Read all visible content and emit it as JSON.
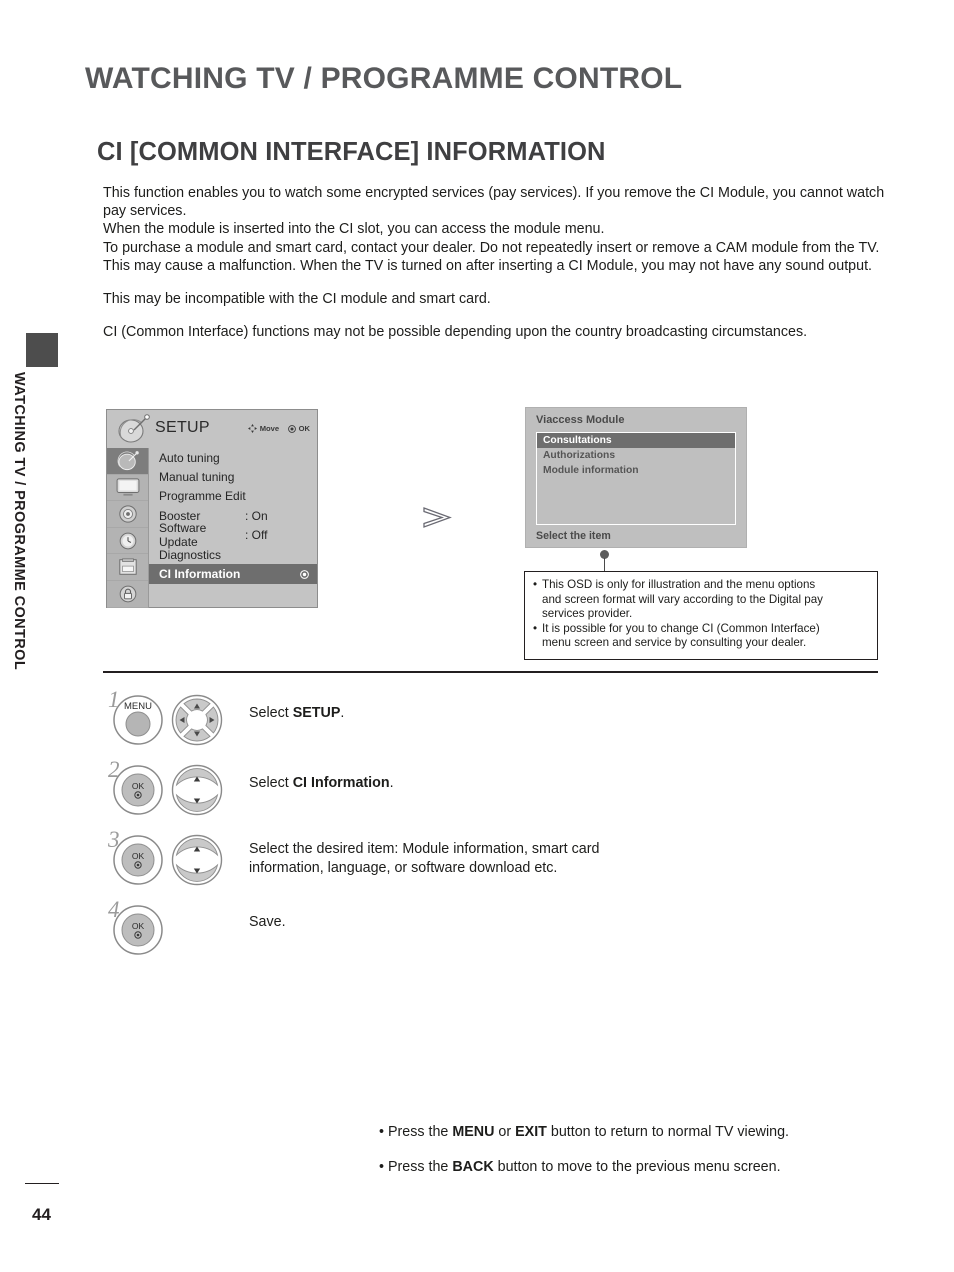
{
  "document": {
    "running_head": "WATCHING TV / PROGRAMME CONTROL",
    "side_tab_text": "WATCHING TV / PROGRAMME CONTROL",
    "section_title": "CI [COMMON INTERFACE] INFORMATION",
    "page_number": "44"
  },
  "body": {
    "paragraph_1": "This function enables you to watch some encrypted services (pay services). If you remove the CI Module, you cannot watch pay services.\nWhen the module is inserted into the CI slot, you can access the module menu.\nTo purchase a module and smart card, contact your dealer. Do not repeatedly insert or remove a CAM module from the TV. This may cause a malfunction. When the TV is turned on after inserting a CI Module, you may not have any sound output.",
    "paragraph_2": "This may be incompatible with the CI module and smart card.",
    "paragraph_3": "CI (Common Interface) functions may not be possible depending upon the country broadcasting circumstances."
  },
  "setup_osd": {
    "title": "SETUP",
    "hint_move": "Move",
    "hint_ok": "OK",
    "sidebar_icons": [
      "satellite-dish-icon",
      "tv-screen-icon",
      "speaker-icon",
      "clock-timer-icon",
      "setup-box-icon",
      "lock-icon"
    ],
    "items": [
      {
        "label": "Auto tuning",
        "value": ""
      },
      {
        "label": "Manual tuning",
        "value": ""
      },
      {
        "label": "Programme Edit",
        "value": ""
      },
      {
        "label": "Booster",
        "value": ": On"
      },
      {
        "label": "Software Update",
        "value": ": Off"
      },
      {
        "label": "Diagnostics",
        "value": ""
      },
      {
        "label": "CI Information",
        "value": "",
        "selected": true
      }
    ]
  },
  "viaccess_osd": {
    "title": "Viaccess Module",
    "items": [
      {
        "label": "Consultations",
        "selected": true
      },
      {
        "label": "Authorizations",
        "selected": false
      },
      {
        "label": "Module information",
        "selected": false
      }
    ],
    "footer": "Select the item"
  },
  "callout": {
    "bullets": [
      "This OSD is only for illustration and the menu options and screen format will vary according to the Digital pay services provider.",
      "It is possible for you to change CI (Common Interface) menu screen and service by consulting your dealer."
    ],
    "bullet_1_lines": [
      "This OSD is only for illustration and the menu options",
      "and screen format will vary according to the Digital pay",
      "services provider."
    ],
    "bullet_2_lines": [
      "It is possible for you to change CI (Common Interface)",
      "menu screen and service by consulting your dealer."
    ]
  },
  "steps": [
    {
      "number": "1",
      "buttons": [
        "MENU",
        "4-way-navigation"
      ],
      "menu_label": "MENU",
      "text_before": "Select ",
      "text_bold": "SETUP",
      "text_after": "."
    },
    {
      "number": "2",
      "buttons": [
        "OK",
        "up-down-navigation"
      ],
      "ok_label": "OK",
      "text_before": "Select ",
      "text_bold": "CI Information",
      "text_after": "."
    },
    {
      "number": "3",
      "buttons": [
        "OK",
        "up-down-navigation"
      ],
      "ok_label": "OK",
      "text_line_1": "Select the desired item: Module information, smart card",
      "text_line_2": "information, language, or software download etc."
    },
    {
      "number": "4",
      "buttons": [
        "OK"
      ],
      "ok_label": "OK",
      "text": "Save."
    }
  ],
  "notes": [
    {
      "pre": "• Press the ",
      "b1": "MENU",
      "mid": " or ",
      "b2": "EXIT",
      "post": " button to return to normal TV viewing."
    },
    {
      "pre": "• Press the ",
      "b1": "BACK",
      "mid": "",
      "b2": "",
      "post": " button to move to the previous menu screen."
    }
  ],
  "colors": {
    "osd_bg": "#c4c4c4",
    "osd_highlight": "#6e6e6e",
    "viaccess_bg": "#bfbfbf",
    "title_gray": "#58595b",
    "text": "#1d1d1b"
  }
}
